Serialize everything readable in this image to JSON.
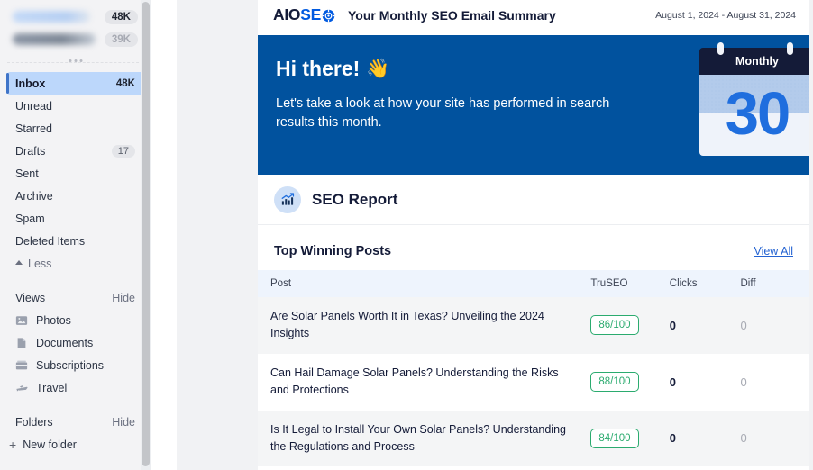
{
  "sidebar": {
    "redacted": [
      {
        "count": "48K",
        "muted": false
      },
      {
        "count": "39K",
        "muted": true
      }
    ],
    "nav": [
      {
        "label": "Inbox",
        "count": "48K",
        "active": true,
        "pill": false
      },
      {
        "label": "Unread",
        "count": "",
        "active": false,
        "pill": false
      },
      {
        "label": "Starred",
        "count": "",
        "active": false,
        "pill": false
      },
      {
        "label": "Drafts",
        "count": "17",
        "active": false,
        "pill": true
      },
      {
        "label": "Sent",
        "count": "",
        "active": false,
        "pill": false
      },
      {
        "label": "Archive",
        "count": "",
        "active": false,
        "pill": false
      },
      {
        "label": "Spam",
        "count": "",
        "active": false,
        "pill": false
      },
      {
        "label": "Deleted Items",
        "count": "",
        "active": false,
        "pill": false
      }
    ],
    "less_label": "Less",
    "views_section": {
      "title": "Views",
      "toggle": "Hide"
    },
    "views": [
      {
        "label": "Photos",
        "icon": "photos-icon"
      },
      {
        "label": "Documents",
        "icon": "document-icon"
      },
      {
        "label": "Subscriptions",
        "icon": "subscriptions-icon"
      },
      {
        "label": "Travel",
        "icon": "travel-plane-icon"
      }
    ],
    "folders_section": {
      "title": "Folders",
      "toggle": "Hide"
    },
    "new_folder_label": "New folder"
  },
  "email": {
    "logo": {
      "part1": "AIO",
      "part2": "SE",
      "mark": "target-icon"
    },
    "title": "Your Monthly SEO Email Summary",
    "date_range": "August 1, 2024 - August 31, 2024",
    "hero": {
      "greeting": "Hi there!",
      "wave": "👋",
      "subtitle": "Let's take a look at how your site has performed in search results this month.",
      "calendar_label": "Monthly",
      "calendar_day": "30",
      "bg_color": "#01529e"
    },
    "report": {
      "icon": "chart-growth-icon",
      "title": "SEO Report",
      "posts_title": "Top Winning Posts",
      "view_all_label": "View All",
      "columns": [
        "Post",
        "TruSEO",
        "Clicks",
        "Diff"
      ],
      "rows": [
        {
          "post": "Are Solar Panels Worth It in Texas? Unveiling the 2024 Insights",
          "truseo": "86/100",
          "clicks": "0",
          "diff": "0"
        },
        {
          "post": "Can Hail Damage Solar Panels? Understanding the Risks and Protections",
          "truseo": "88/100",
          "clicks": "0",
          "diff": "0"
        },
        {
          "post": "Is It Legal to Install Your Own Solar Panels? Understanding the Regulations and Process",
          "truseo": "84/100",
          "clicks": "0",
          "diff": "0"
        }
      ]
    }
  },
  "colors": {
    "brand_blue": "#005ae0",
    "hero_blue": "#01529e",
    "navy": "#141b38",
    "score_green": "#2bab6f",
    "link_blue": "#2463d2",
    "active_row": "#bcd7fb"
  }
}
